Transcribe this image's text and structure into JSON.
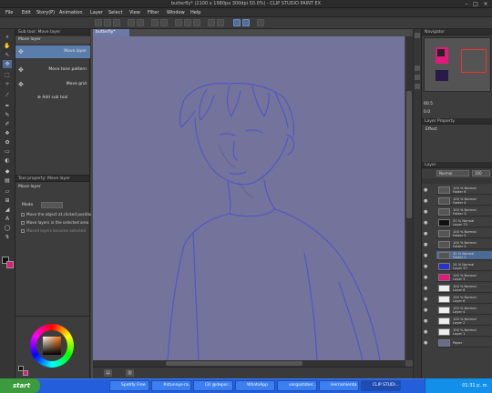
{
  "window": {
    "title": "butterfly* (2100 x 1980px 300dpi 50.0%) - CLIP STUDIO PAINT EX"
  },
  "menu": [
    "File",
    "Edit",
    "Story(P)",
    "Animation",
    "Layer",
    "Select",
    "View",
    "Filter",
    "Window",
    "Help"
  ],
  "subtool": {
    "header": "Sub tool: Move layer",
    "group": "Move layer",
    "items": [
      "Move layer",
      "Move tone pattern",
      "Move grid"
    ],
    "add": "Add sub tool"
  },
  "toolprop": {
    "header": "Tool property: Move layer",
    "title": "Move layer",
    "mode_label": "Mode",
    "checks": [
      "Move the object at clicked position",
      "Move layers in the selected area",
      "Moved layers become selected"
    ]
  },
  "document": {
    "tab": "butterfly*"
  },
  "navigator": {
    "header": "Navigator",
    "zoom": "60.5",
    "angle": "0.0"
  },
  "layer_property": {
    "header": "Layer Property",
    "effect": "Effect"
  },
  "layers": {
    "header": "Layer",
    "blend": "Normal",
    "opacity": "100",
    "rows": [
      {
        "line1": "100 % Normal",
        "line2": "Folder 6"
      },
      {
        "line1": "100 % Normal",
        "line2": "Folder 4"
      },
      {
        "line1": "100 % Normal",
        "line2": "Folder 3"
      },
      {
        "line1": "37 % Normal",
        "line2": "Layer 73"
      },
      {
        "line1": "100 % Normal",
        "line2": "Folder 5"
      },
      {
        "line1": "100 % Normal",
        "line2": "Folder 2"
      },
      {
        "line1": "30 % Normal",
        "line2": "Folder 1"
      },
      {
        "line1": "24 % Normal",
        "line2": "Layer 37"
      },
      {
        "line1": "100 % Normal",
        "line2": "Layer 3"
      },
      {
        "line1": "100 % Normal",
        "line2": "Layer 8"
      },
      {
        "line1": "100 % Normal",
        "line2": "Layer 6"
      },
      {
        "line1": "100 % Normal",
        "line2": "Layer 4"
      },
      {
        "line1": "100 % Normal",
        "line2": "Layer 2"
      },
      {
        "line1": "100 % Normal",
        "line2": "Layer 1"
      },
      {
        "line1": "",
        "line2": "Paper"
      }
    ]
  },
  "taskbar": {
    "start": "start",
    "items": [
      "Spotify Free",
      "#stunnys-ra...",
      "(3) @depor...",
      "WhatsApp",
      "vargastsber...",
      "Herramienta...",
      "CLIP STUDI..."
    ],
    "time": "01:31 p. m."
  },
  "colors": {
    "canvas": "#74739b",
    "accent": "#4c6a93",
    "sketch": "#4a4fd0"
  }
}
